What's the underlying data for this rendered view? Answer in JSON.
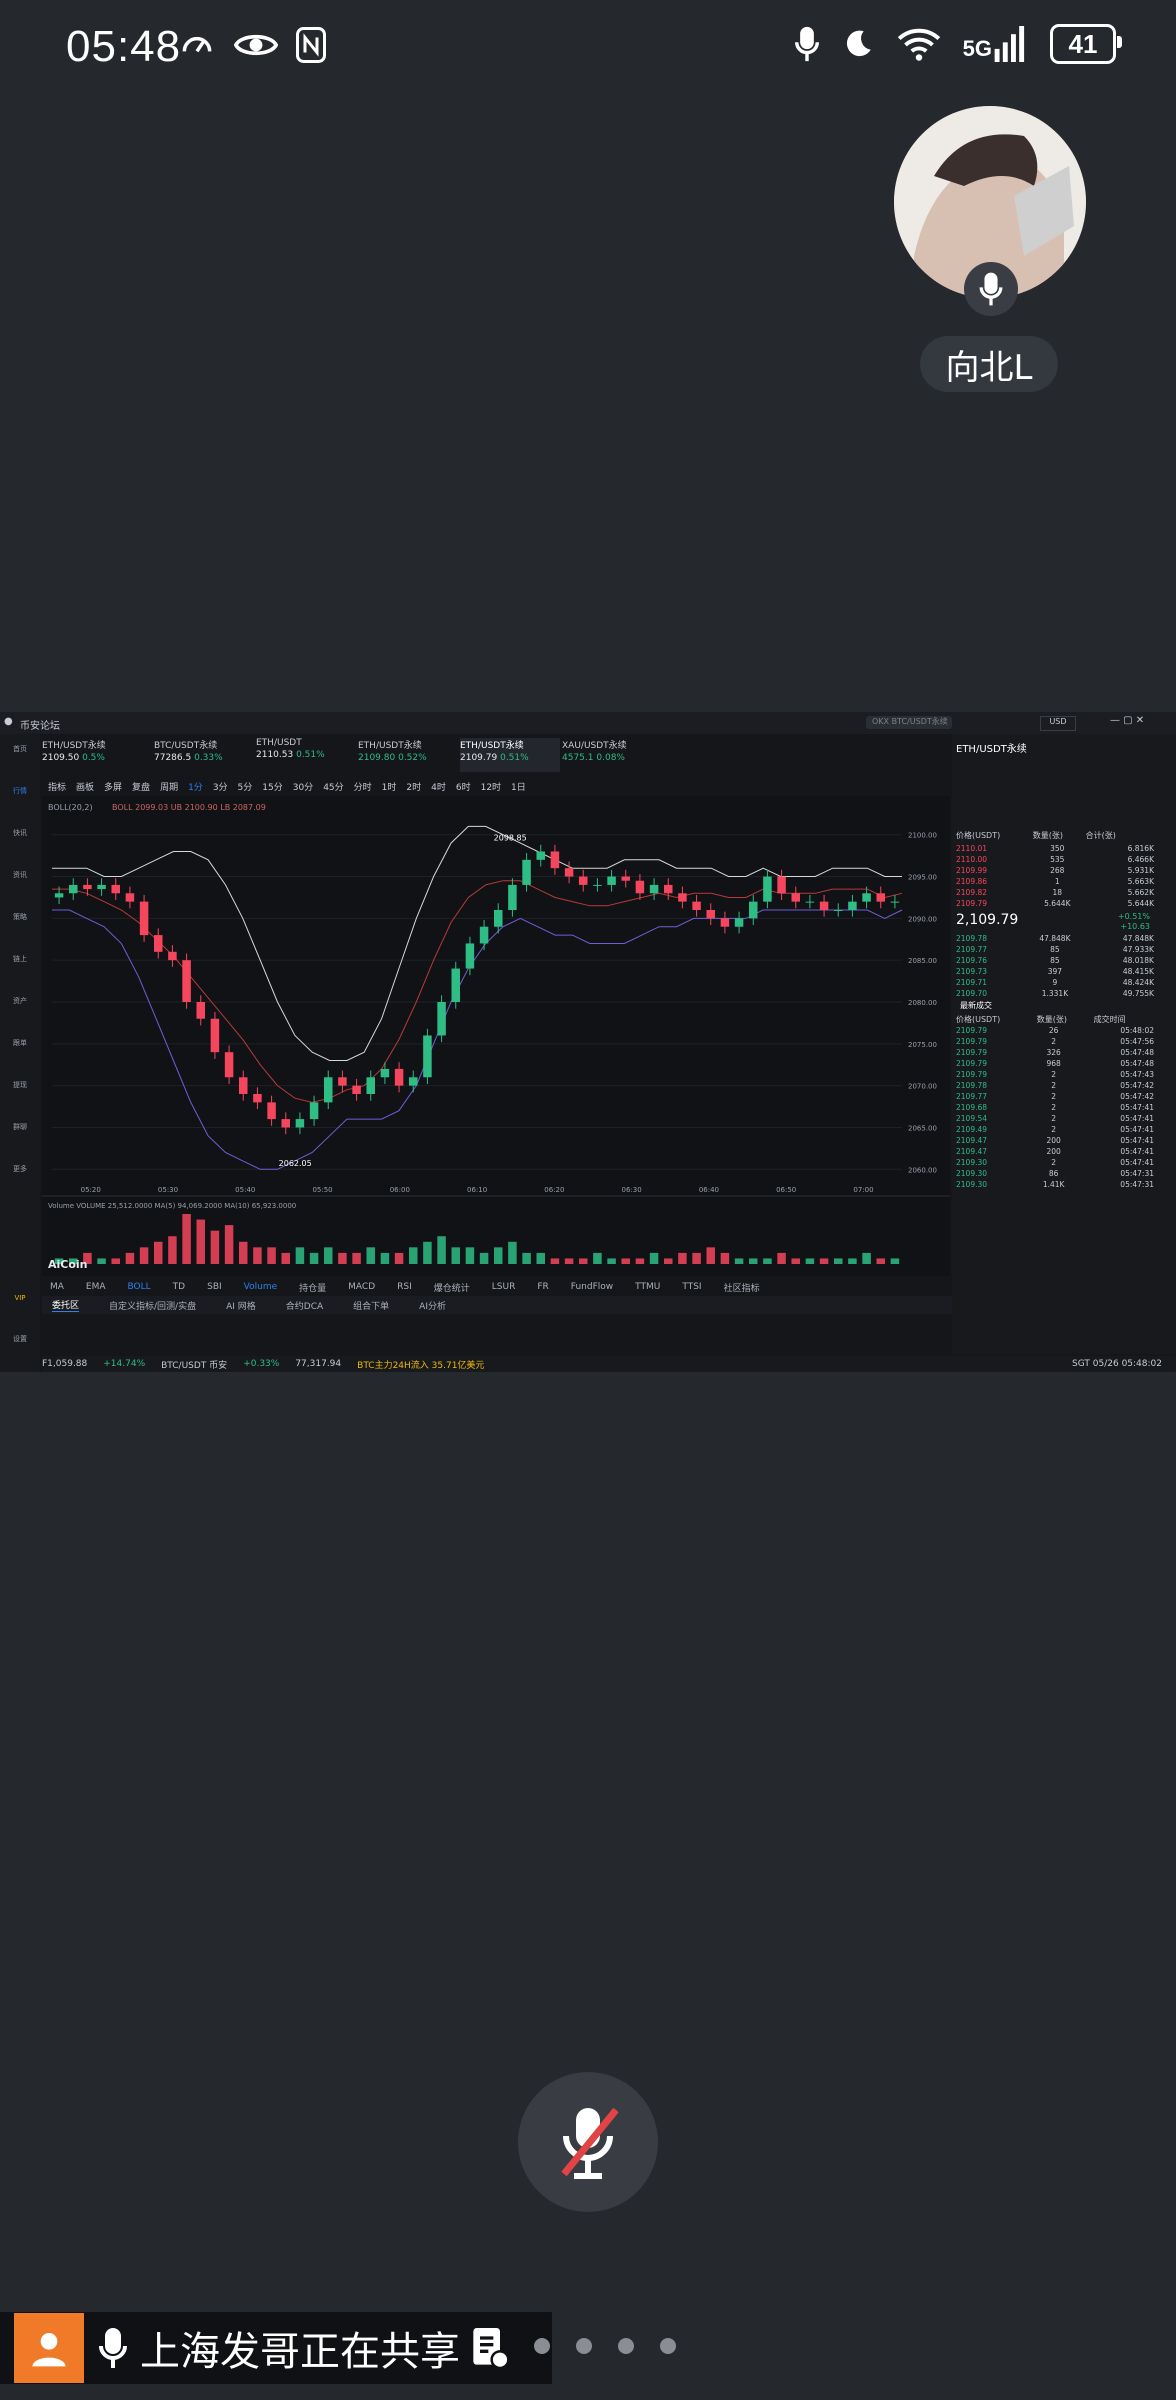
{
  "status_bar": {
    "time": "05:48",
    "network": "5G",
    "battery": "41"
  },
  "participant": {
    "name": "向北L"
  },
  "share": {
    "banner": "上海发哥正在共享"
  },
  "app": {
    "title": "币安论坛",
    "search_placeholder": "OKX BTC/USDT永续",
    "currency": "USD",
    "tabs": [
      {
        "name": "ETH/USDT永续",
        "price": "2109.50",
        "change": "0.5%",
        "dir": "up"
      },
      {
        "name": "BTC/USDT永续",
        "price": "77286.5",
        "change": "0.33%",
        "dir": "up"
      },
      {
        "name": "ETH/USDT",
        "price": "2110.53",
        "change": "0.51%",
        "dir": "up"
      },
      {
        "name": "ETH/USDT永续",
        "price": "2109.80",
        "change": "0.52%",
        "dir": "up"
      },
      {
        "name": "ETH/USDT永续",
        "price": "2109.79",
        "change": "0.51%",
        "dir": "up"
      },
      {
        "name": "XAU/USDT永续",
        "price": "4575.1",
        "change": "0.08%",
        "dir": "up"
      }
    ],
    "toolbar": [
      "指标",
      "画板",
      "多屏",
      "复盘",
      "周期",
      "1分",
      "3分",
      "5分",
      "15分",
      "30分",
      "45分",
      "分时",
      "1时",
      "2时",
      "4时",
      "6时",
      "12时",
      "1日"
    ],
    "toolbar_selected": "1分",
    "rail": [
      "首页",
      "行情",
      "快讯",
      "资讯",
      "策略",
      "链上",
      "资产",
      "跟单",
      "提现",
      "群聊",
      "更多",
      "VIP",
      "设置"
    ],
    "indicator_label": "BOLL(20,2)",
    "indicator_values": "BOLL 2099.03  UB 2100.90  LB 2087.09",
    "volume_label": "Volume  VOLUME 25,512.0000  MA(5) 94,069.2000  MA(10) 65,923.0000",
    "logo": "AiCoin",
    "bottom_tabs": [
      "MA",
      "EMA",
      "BOLL",
      "TD",
      "SBI",
      "Volume",
      "持仓量",
      "MACD",
      "RSI",
      "爆仓统计",
      "LSUR",
      "FR",
      "FundFlow",
      "TTMU",
      "TTSI",
      "社区指标"
    ],
    "bottom_tabs2": [
      "委托区",
      "自定义指标/回测/实盘",
      "AI 网格",
      "合约DCA",
      "组合下单",
      "AI分析"
    ],
    "ticker": [
      "F1,059.88",
      "+14.74%",
      "BTC/USDT 币安",
      "+0.33%",
      "77,317.94",
      "BTC主力24H流入 35.71亿美元",
      "SGT 05/26 05:48:02"
    ]
  },
  "orderbook": {
    "symbol": "ETH/USDT永续",
    "last_price": "2,109.79",
    "last_change": "+0.51%",
    "last_change_abs": "+10.63",
    "headers": [
      "价格(USDT)",
      "数量(张)",
      "合计(张)"
    ],
    "asks": [
      [
        "2110.01",
        "350",
        "6.816K"
      ],
      [
        "2110.00",
        "535",
        "6.466K"
      ],
      [
        "2109.99",
        "268",
        "5.931K"
      ],
      [
        "2109.86",
        "1",
        "5.663K"
      ],
      [
        "2109.82",
        "18",
        "5.662K"
      ],
      [
        "2109.79",
        "5.644K",
        "5.644K"
      ]
    ],
    "bids": [
      [
        "2109.78",
        "47.848K",
        "47.848K"
      ],
      [
        "2109.77",
        "85",
        "47.933K"
      ],
      [
        "2109.76",
        "85",
        "48.018K"
      ],
      [
        "2109.73",
        "397",
        "48.415K"
      ],
      [
        "2109.71",
        "9",
        "48.424K"
      ],
      [
        "2109.70",
        "1.331K",
        "49.755K"
      ]
    ],
    "trades_title": "最新成交",
    "trades_headers": [
      "价格(USDT)",
      "数量(张)",
      "成交时间"
    ],
    "trades": [
      [
        "2109.79",
        "26",
        "05:48:02"
      ],
      [
        "2109.79",
        "2",
        "05:47:56"
      ],
      [
        "2109.79",
        "326",
        "05:47:48"
      ],
      [
        "2109.79",
        "968",
        "05:47:48"
      ],
      [
        "2109.79",
        "2",
        "05:47:43"
      ],
      [
        "2109.78",
        "2",
        "05:47:42"
      ],
      [
        "2109.77",
        "2",
        "05:47:42"
      ],
      [
        "2109.68",
        "2",
        "05:47:41"
      ],
      [
        "2109.54",
        "2",
        "05:47:41"
      ],
      [
        "2109.49",
        "2",
        "05:47:41"
      ],
      [
        "2109.47",
        "200",
        "05:47:41"
      ],
      [
        "2109.47",
        "200",
        "05:47:41"
      ],
      [
        "2109.30",
        "2",
        "05:47:41"
      ],
      [
        "2109.30",
        "86",
        "05:47:31"
      ],
      [
        "2109.30",
        "1.41K",
        "05:47:31"
      ]
    ]
  },
  "chart_data": {
    "type": "line",
    "title": "",
    "y_ticks": [
      "2100.00",
      "2095.00",
      "2090.00",
      "2085.00",
      "2080.00",
      "2075.00",
      "2070.00",
      "2065.00",
      "2060.00"
    ],
    "x_ticks": [
      "05:20",
      "05:30",
      "05:40",
      "05:50",
      "06:00",
      "06:10",
      "06:20",
      "06:30",
      "06:40",
      "06:50",
      "07:00"
    ],
    "annotations": [
      "2098.85",
      "2062.05"
    ],
    "ylim": [
      2058,
      2102
    ],
    "close": [
      2093,
      2094,
      2093.5,
      2094,
      2093,
      2092,
      2088,
      2086,
      2085,
      2080,
      2078,
      2074,
      2071,
      2069,
      2068,
      2066,
      2065,
      2066,
      2068,
      2071,
      2070,
      2069,
      2071,
      2072,
      2070,
      2071,
      2076,
      2080,
      2084,
      2087,
      2089,
      2091,
      2094,
      2097,
      2098,
      2096,
      2095,
      2094,
      2094,
      2095,
      2094.5,
      2093,
      2094,
      2093,
      2092,
      2091,
      2090,
      2089,
      2090,
      2092,
      2095,
      2093,
      2092,
      2092,
      2091,
      2091,
      2092,
      2093,
      2092,
      2092
    ],
    "ub": [
      2096,
      2096,
      2096,
      2095,
      2095,
      2096,
      2097,
      2098,
      2098,
      2097,
      2094,
      2090,
      2085,
      2080,
      2076,
      2074,
      2073,
      2073,
      2074,
      2078,
      2084,
      2090,
      2095,
      2099,
      2101,
      2101,
      2100,
      2099,
      2098,
      2097,
      2096,
      2096,
      2096,
      2097,
      2097,
      2097,
      2096,
      2096,
      2096,
      2095,
      2095,
      2096,
      2095,
      2095,
      2095,
      2096,
      2096,
      2096,
      2095,
      2095
    ],
    "lb": [
      2091,
      2091,
      2090,
      2089,
      2087,
      2083,
      2078,
      2073,
      2068,
      2064,
      2062,
      2061,
      2060,
      2060,
      2061,
      2062,
      2064,
      2066,
      2066,
      2066,
      2067,
      2070,
      2075,
      2080,
      2084,
      2087,
      2089,
      2090,
      2089,
      2088,
      2088,
      2087,
      2087,
      2087,
      2088,
      2089,
      2089,
      2090,
      2090,
      2090,
      2090,
      2091,
      2091,
      2091,
      2091,
      2091,
      2091,
      2091,
      2090,
      2091
    ],
    "volume": [
      1,
      1,
      2,
      1,
      1,
      2,
      3,
      4,
      5,
      9,
      8,
      6,
      7,
      4,
      3,
      3,
      2,
      3,
      2,
      3,
      2,
      2,
      3,
      2,
      2,
      3,
      4,
      5,
      3,
      3,
      2,
      3,
      4,
      2,
      2,
      1,
      1,
      1,
      2,
      1,
      1,
      1,
      2,
      1,
      2,
      2,
      3,
      2,
      1,
      1,
      1,
      2,
      1,
      1,
      1,
      1,
      1,
      2,
      1,
      1
    ]
  }
}
